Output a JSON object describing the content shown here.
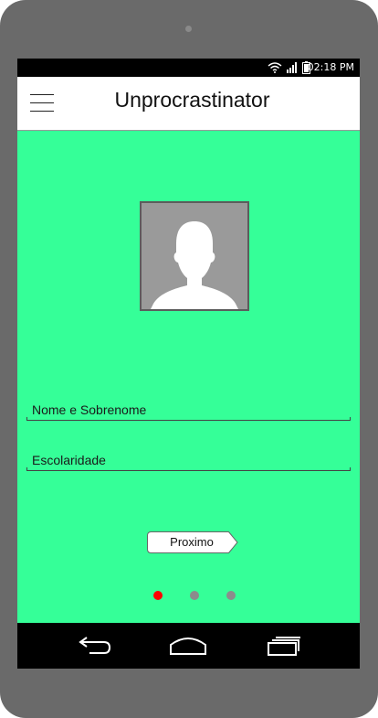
{
  "status_bar": {
    "time": "02:18 PM",
    "icons": [
      "wifi-icon",
      "signal-icon",
      "battery-icon"
    ]
  },
  "app_bar": {
    "title": "Unprocrastinator",
    "menu_icon": "hamburger-menu-icon"
  },
  "profile": {
    "avatar_icon": "person-silhouette-icon"
  },
  "form": {
    "name_label": "Nome e Sobrenome",
    "education_label": "Escolaridade",
    "next_label": "Proximo"
  },
  "pager": {
    "count": 3,
    "active_index": 0,
    "active_color": "#ff0000",
    "inactive_color": "#8c8c8c"
  },
  "nav_bar": {
    "icons": [
      "back-icon",
      "home-icon",
      "recent-apps-icon"
    ]
  },
  "colors": {
    "screen_background": "#35ff98",
    "device_frame": "#6a6a6a"
  }
}
